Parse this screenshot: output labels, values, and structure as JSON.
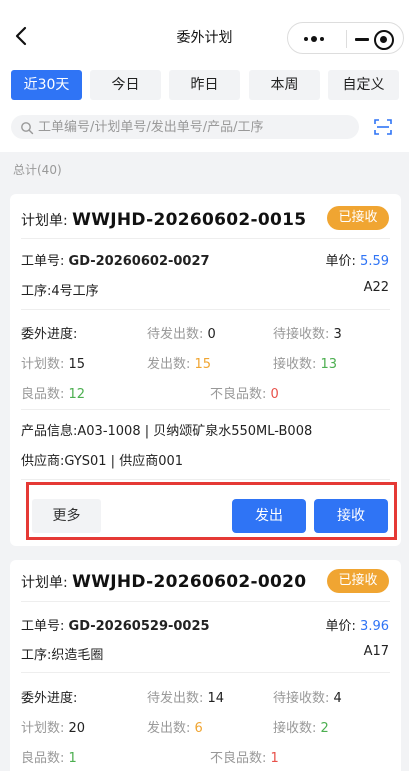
{
  "nav": {
    "title": "委外计划"
  },
  "tabs": [
    "近30天",
    "今日",
    "昨日",
    "本周",
    "自定义"
  ],
  "search": {
    "placeholder": "工单编号/计划单号/发出单号/产品/工序"
  },
  "total": "总计(40)",
  "labels": {
    "plan": "计划单:",
    "work": "工单号:",
    "price": "单价:",
    "process": "工序:",
    "progress": "委外进度:",
    "to_send": "待发出数:",
    "to_receive": "待接收数:",
    "plan_qty": "计划数:",
    "sent": "发出数:",
    "received": "接收数:",
    "good": "良品数:",
    "bad": "不良品数:",
    "product": "产品信息:",
    "supplier": "供应商:"
  },
  "buttons": {
    "more": "更多",
    "send": "发出",
    "receive": "接收"
  },
  "cards": [
    {
      "plan_no": "WWJHD-20260602-0015",
      "status": "已接收",
      "work_no": "GD-20260602-0027",
      "price": "5.59",
      "process": "4号工序",
      "process_code": "A22",
      "to_send": "0",
      "to_receive": "3",
      "plan_qty": "15",
      "sent": "15",
      "received": "13",
      "good": "12",
      "bad": "0",
      "product": "A03-1008 | 贝纳颂矿泉水550ML-B008",
      "supplier": "GYS01 | 供应商001"
    },
    {
      "plan_no": "WWJHD-20260602-0020",
      "status": "已接收",
      "work_no": "GD-20260529-0025",
      "price": "3.96",
      "process": "织造毛圈",
      "process_code": "A17",
      "to_send": "14",
      "to_receive": "4",
      "plan_qty": "20",
      "sent": "6",
      "received": "2",
      "good": "1",
      "bad": "1"
    }
  ],
  "colors": {
    "accent": "#2f74f5",
    "badge": "#f0a532",
    "good": "#4caf50",
    "bad": "#e8514a",
    "highlight": "#e53935"
  }
}
